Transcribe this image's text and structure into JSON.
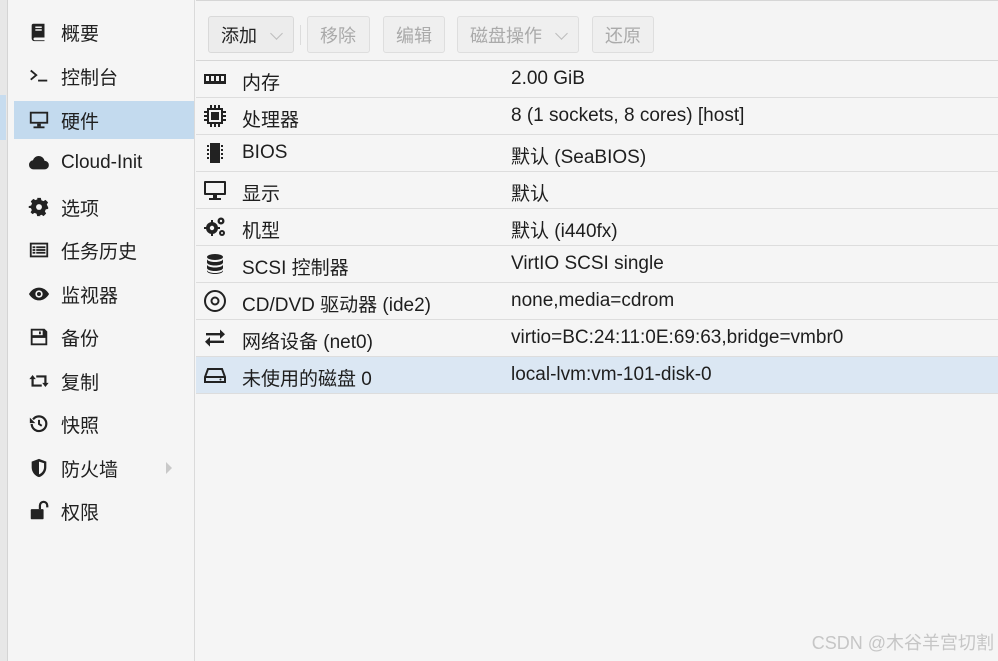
{
  "sidebar": {
    "items": [
      {
        "label": "概要",
        "icon": "book-icon",
        "active": false
      },
      {
        "label": "控制台",
        "icon": "terminal-icon",
        "active": false
      },
      {
        "label": "硬件",
        "icon": "monitor-icon",
        "active": true
      },
      {
        "label": "Cloud-Init",
        "icon": "cloud-icon",
        "active": false
      },
      {
        "label": "选项",
        "icon": "gear-icon",
        "active": false
      },
      {
        "label": "任务历史",
        "icon": "list-icon",
        "active": false
      },
      {
        "label": "监视器",
        "icon": "eye-icon",
        "active": false
      },
      {
        "label": "备份",
        "icon": "floppy-disk-icon",
        "active": false
      },
      {
        "label": "复制",
        "icon": "retweet-icon",
        "active": false
      },
      {
        "label": "快照",
        "icon": "history-icon",
        "active": false
      },
      {
        "label": "防火墙",
        "icon": "shield-icon",
        "active": false
      },
      {
        "label": "权限",
        "icon": "unlock-icon",
        "active": false
      }
    ]
  },
  "toolbar": {
    "add_label": "添加",
    "remove_label": "移除",
    "edit_label": "编辑",
    "disk_action_label": "磁盘操作",
    "revert_label": "还原"
  },
  "hardware": {
    "rows": [
      {
        "key": "内存",
        "value": "2.00 GiB",
        "icon": "memory-icon"
      },
      {
        "key": "处理器",
        "value": "8 (1 sockets, 8 cores) [host]",
        "icon": "cpu-icon"
      },
      {
        "key": "BIOS",
        "value": "默认 (SeaBIOS)",
        "icon": "microchip-icon"
      },
      {
        "key": "显示",
        "value": "默认",
        "icon": "desktop-icon"
      },
      {
        "key": "机型",
        "value": "默认 (i440fx)",
        "icon": "cogs-icon"
      },
      {
        "key": "SCSI 控制器",
        "value": "VirtIO SCSI single",
        "icon": "database-icon"
      },
      {
        "key": "CD/DVD 驱动器 (ide2)",
        "value": "none,media=cdrom",
        "icon": "cdrom-icon"
      },
      {
        "key": "网络设备 (net0)",
        "value": "virtio=BC:24:11:0E:69:63,bridge=vmbr0",
        "icon": "exchange-icon"
      },
      {
        "key": "未使用的磁盘 0",
        "value": "local-lvm:vm-101-disk-0",
        "icon": "hdd-icon"
      }
    ]
  },
  "watermark": "CSDN @木谷羊宫切割",
  "colors": {
    "active_nav": "#c3daee",
    "selected_row": "#dbe7f3",
    "background": "#f5f5f5"
  }
}
